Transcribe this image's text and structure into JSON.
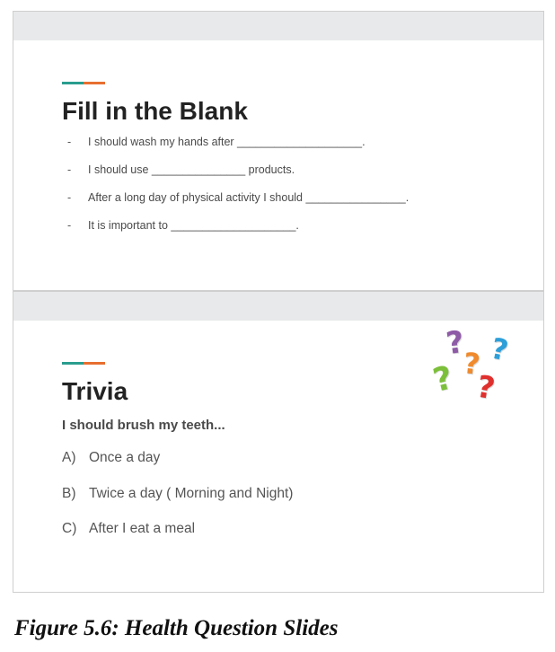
{
  "slides": [
    {
      "title": "Fill in the Blank",
      "items": [
        "I should wash my hands after ____________________.",
        "I should use _______________ products.",
        "After a long day of physical activity I should ________________.",
        "It is important to ____________________."
      ]
    },
    {
      "title": "Trivia",
      "question": "I should brush my teeth...",
      "options": [
        {
          "letter": "A)",
          "text": "Once a day"
        },
        {
          "letter": "B)",
          "text": "Twice a day ( Morning and Night)"
        },
        {
          "letter": "C)",
          "text": "After I eat a meal"
        }
      ],
      "clipart": {
        "icon": "question-marks-icon",
        "glyph": "?",
        "colors": [
          "#8e5ba6",
          "#f08a2c",
          "#2d9fd9",
          "#7cbf3a",
          "#e0302e"
        ]
      }
    }
  ],
  "accent_colors": {
    "teal": "#2a9d8f",
    "orange": "#e76f2f"
  },
  "caption": "Figure 5.6: Health Question Slides"
}
